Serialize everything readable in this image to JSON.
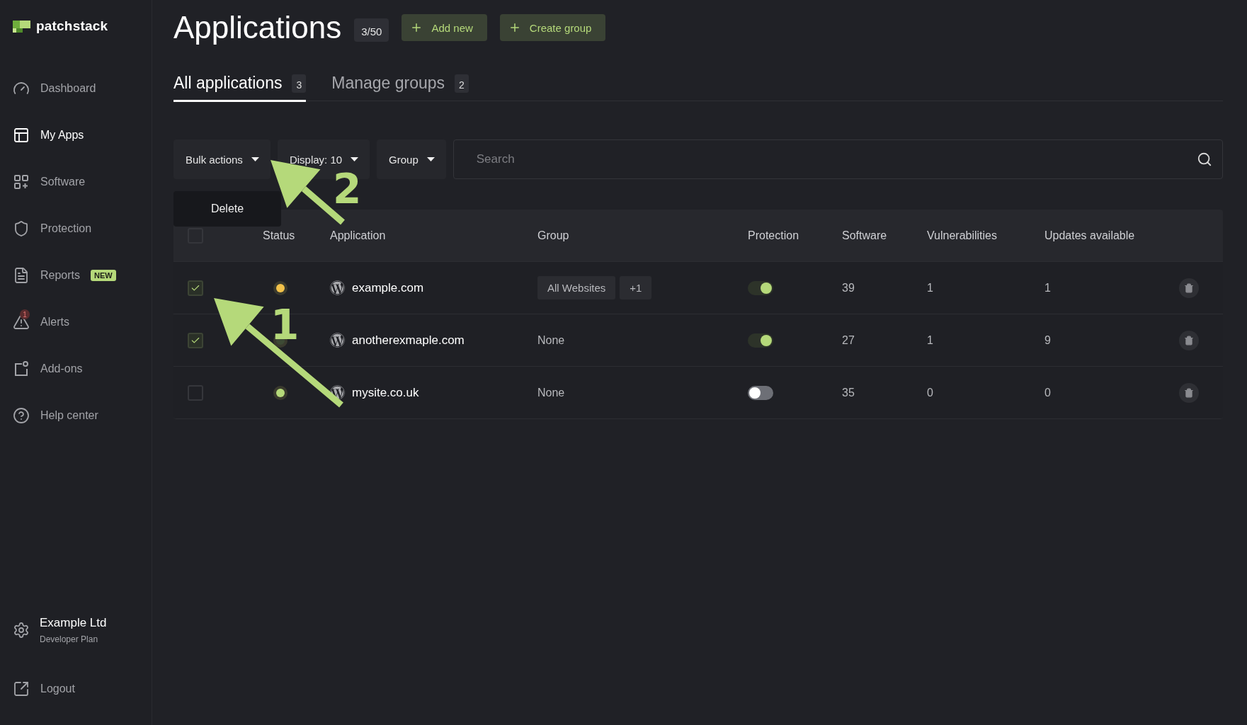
{
  "sidebar": {
    "logo": "patchstack",
    "items": [
      {
        "label": "Dashboard",
        "selected": false
      },
      {
        "label": "My Apps",
        "selected": true
      },
      {
        "label": "Software",
        "selected": false
      },
      {
        "label": "Protection",
        "selected": false
      },
      {
        "label": "Reports",
        "selected": false,
        "tag": "NEW"
      },
      {
        "label": "Alerts",
        "selected": false,
        "count": "1"
      },
      {
        "label": "Add-ons",
        "selected": false
      },
      {
        "label": "Help center",
        "selected": false
      }
    ],
    "account": {
      "name": "Example Ltd",
      "plan": "Developer Plan"
    },
    "logout": "Logout"
  },
  "header": {
    "title": "Applications",
    "quota": "3/50",
    "buttons": [
      "Add new",
      "Create group"
    ]
  },
  "tabs": [
    {
      "label": "All applications",
      "count": "3",
      "selected": true
    },
    {
      "label": "Manage groups",
      "count": "2",
      "selected": false
    }
  ],
  "toolbar": {
    "dropdowns": [
      "Bulk actions",
      "Display: 10",
      "Group"
    ],
    "search": {
      "placeholder": "Search"
    }
  },
  "bulk_menu": {
    "items": [
      "Delete"
    ]
  },
  "table": {
    "select_all": {
      "checked": false
    },
    "columns": [
      "Status",
      "Application",
      "Group",
      "Protection",
      "Software",
      "Vulnerabilities",
      "Updates available"
    ],
    "rows": [
      {
        "checked": true,
        "color": "#f2c14a",
        "application": "example.com",
        "group": {
          "kind": "tags",
          "items": [
            "All Websites",
            "+1"
          ]
        },
        "protection": true,
        "software": "39",
        "vulnerabilities": "1",
        "updates": "1"
      },
      {
        "checked": true,
        "color": "#3d4a35",
        "application": "anotherexmaple.com",
        "group": {
          "kind": "text",
          "text": "None"
        },
        "protection": true,
        "software": "27",
        "vulnerabilities": "1",
        "updates": "9"
      },
      {
        "checked": false,
        "color": "#b5d97a",
        "application": "mysite.co.uk",
        "group": {
          "kind": "text",
          "text": "None"
        },
        "protection": false,
        "software": "35",
        "vulnerabilities": "0",
        "updates": "0"
      }
    ]
  },
  "annotations": [
    {
      "label": "1"
    },
    {
      "label": "2"
    }
  ]
}
